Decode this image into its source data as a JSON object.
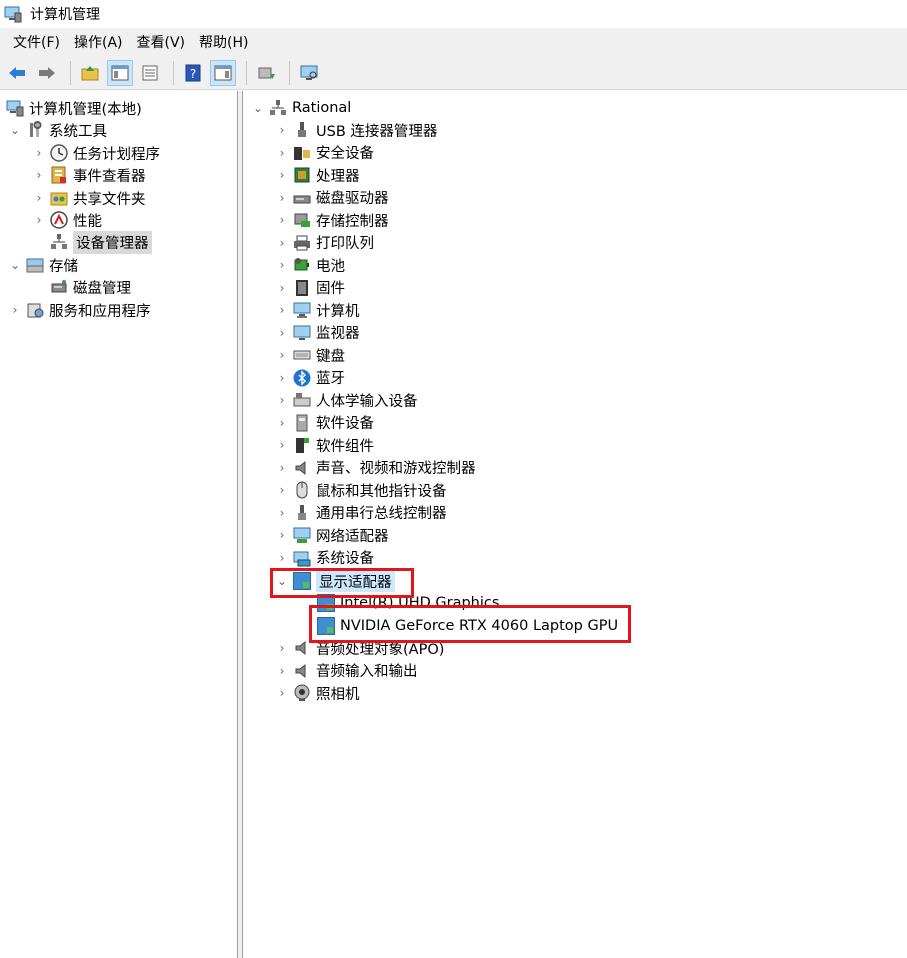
{
  "window": {
    "title": "计算机管理"
  },
  "menu": [
    "文件(F)",
    "操作(A)",
    "查看(V)",
    "帮助(H)"
  ],
  "toolbar": {
    "buttons": [
      "back-arrow-icon",
      "forward-arrow-icon",
      "up-folder-icon",
      "console-tree-icon",
      "properties-icon",
      "help-icon",
      "action-pane-icon",
      "update-driver-icon",
      "scan-hardware-icon"
    ]
  },
  "left_tree": {
    "root": "计算机管理(本地)",
    "system_tools": "系统工具",
    "task_scheduler": "任务计划程序",
    "event_viewer": "事件查看器",
    "shared_folders": "共享文件夹",
    "performance": "性能",
    "device_manager": "设备管理器",
    "storage": "存储",
    "disk_management": "磁盘管理",
    "services_apps": "服务和应用程序"
  },
  "device_tree": {
    "root": "Rational",
    "categories": [
      "USB 连接器管理器",
      "安全设备",
      "处理器",
      "磁盘驱动器",
      "存储控制器",
      "打印队列",
      "电池",
      "固件",
      "计算机",
      "监视器",
      "键盘",
      "蓝牙",
      "人体学输入设备",
      "软件设备",
      "软件组件",
      "声音、视频和游戏控制器",
      "鼠标和其他指针设备",
      "通用串行总线控制器",
      "网络适配器",
      "系统设备"
    ],
    "display_adapters": "显示适配器",
    "display_children": [
      "Intel(R) UHD Graphics",
      "NVIDIA GeForce RTX 4060 Laptop GPU"
    ],
    "after": [
      "音频处理对象(APO)",
      "音频输入和输出",
      "照相机"
    ]
  }
}
